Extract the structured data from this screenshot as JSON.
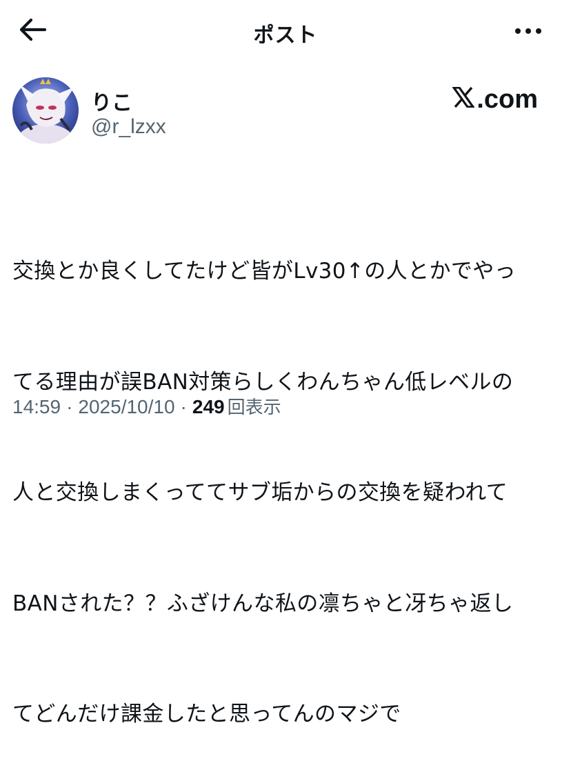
{
  "header": {
    "title": "ポスト",
    "back_icon": "arrow-left-icon",
    "more_icon": "more-horizontal-icon"
  },
  "author": {
    "display_name": "りこ",
    "handle": "@r_lzxx",
    "avatar_icon": "avatar-image",
    "source_label": ".com",
    "source_logo": "x-logo-icon"
  },
  "tweet": {
    "lines": [
      "交換とか良くしてたけど皆がLv30↑の人とかでやっ",
      "てる理由が誤BAN対策らしくわんちゃん低レベルの",
      "人と交換しまくっててサブ垢からの交換を疑われて",
      "BANされた？？ふざけんな私の凛ちゃと冴ちゃ返し",
      "てどんだけ課金したと思ってんのマジで"
    ]
  },
  "meta": {
    "time": "14:59",
    "separator": "·",
    "date": "2025/10/10",
    "views_count": "249",
    "views_label": "回表示"
  },
  "colors": {
    "text_primary": "#0f1419",
    "text_secondary": "#536471",
    "background": "#ffffff"
  }
}
